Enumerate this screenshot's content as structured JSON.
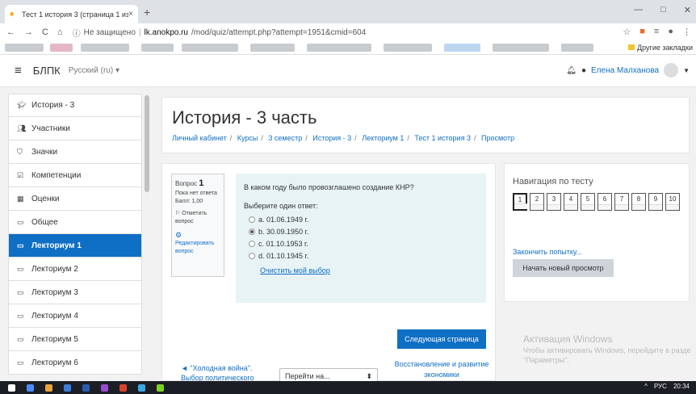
{
  "browser": {
    "tab_title": "Тест 1 история 3 (страница 1 из",
    "tab_close": "×",
    "new_tab": "+",
    "window_controls": [
      "—",
      "□",
      "✕"
    ],
    "security_label": "Не защищено",
    "host": "lk.anokpo.ru",
    "path": "/mod/quiz/attempt.php?attempt=1951&cmid=604",
    "other_bookmarks": "Другие закладки"
  },
  "header": {
    "brand": "БЛПК",
    "language": "Русский (ru)",
    "user_name": "Елена Малханова"
  },
  "sidebar": {
    "items": [
      {
        "label": "История - 3",
        "icon": "graduation-cap"
      },
      {
        "label": "Участники",
        "icon": "users"
      },
      {
        "label": "Значки",
        "icon": "shield"
      },
      {
        "label": "Компетенции",
        "icon": "checkbox"
      },
      {
        "label": "Оценки",
        "icon": "table"
      },
      {
        "label": "Общее",
        "icon": "folder"
      },
      {
        "label": "Лекториум 1",
        "icon": "folder",
        "active": true
      },
      {
        "label": "Лекториум 2",
        "icon": "folder"
      },
      {
        "label": "Лекториум 3",
        "icon": "folder"
      },
      {
        "label": "Лекториум 4",
        "icon": "folder"
      },
      {
        "label": "Лекториум 5",
        "icon": "folder"
      },
      {
        "label": "Лекториум 6",
        "icon": "folder"
      }
    ]
  },
  "page": {
    "title": "История - 3 часть",
    "breadcrumbs": [
      "Личный кабинет",
      "Курсы",
      "3 семестр",
      "История - 3",
      "Лекториум 1",
      "Тест 1 история 3",
      "Просмотр"
    ]
  },
  "question": {
    "label": "Вопрос",
    "number": "1",
    "status": "Пока нет ответа",
    "points": "Балл: 1,00",
    "flag": "Отметить вопрос",
    "edit": "Редактировать вопрос",
    "text": "В каком году было провозглашено создание КНР?",
    "prompt": "Выберите один ответ:",
    "options": [
      {
        "label": "a. 01.06.1949 г.",
        "selected": false
      },
      {
        "label": "b. 30.09.1950 г.",
        "selected": true
      },
      {
        "label": "c. 01.10.1953 г.",
        "selected": false
      },
      {
        "label": "d. 01.10.1945 г.",
        "selected": false
      }
    ],
    "clear": "Очистить мой выбор"
  },
  "footer_nav": {
    "next_button": "Следующая страница",
    "prev_link": "◄ \"Холодная война\". Выбор политического",
    "jump_placeholder": "Перейти на...",
    "next_link": "Восстановление и развитие экономики"
  },
  "quiz_nav": {
    "title": "Навигация по тесту",
    "buttons": [
      "1",
      "2",
      "3",
      "4",
      "5",
      "6",
      "7",
      "8",
      "9",
      "10"
    ],
    "current": "1",
    "finish": "Закончить попытку...",
    "new_preview": "Начать новый просмотр"
  },
  "activation": {
    "heading": "Активация Windows",
    "text": "Чтобы активировать Windows, перейдите в раздел \"Параметры\"."
  },
  "taskbar": {
    "lang": "РУС",
    "time": "20:34",
    "icon_colors": [
      "#ffffff",
      "#4a8cff",
      "#e8a33c",
      "#3b7dd8",
      "#2a5db0",
      "#9a4bd1",
      "#d9442e",
      "#3aa7e0",
      "#7ed321"
    ]
  }
}
